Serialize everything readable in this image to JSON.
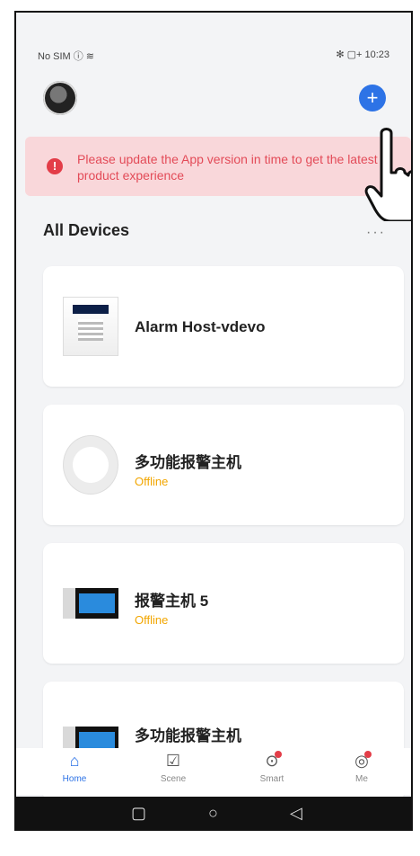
{
  "status_bar": {
    "left": "No SIM ⓘ ≋",
    "right": "✻ ▢+ 10:23"
  },
  "header": {
    "add_symbol": "+"
  },
  "banner": {
    "icon": "!",
    "message": "Please update the App version in time to get the latest product experience"
  },
  "section": {
    "title": "All Devices",
    "more": "···"
  },
  "devices": [
    {
      "name": "Alarm Host-vdevo",
      "status": ""
    },
    {
      "name": "多功能报警主机",
      "status": "Offline"
    },
    {
      "name": "报警主机 5",
      "status": "Offline"
    },
    {
      "name": "多功能报警主机",
      "status": ""
    }
  ],
  "tabs": [
    {
      "label": "Home",
      "icon": "home-icon",
      "glyph": "⌂"
    },
    {
      "label": "Scene",
      "icon": "scene-icon",
      "glyph": "☑"
    },
    {
      "label": "Smart",
      "icon": "smart-icon",
      "glyph": "⊙"
    },
    {
      "label": "Me",
      "icon": "me-icon",
      "glyph": "◎"
    }
  ],
  "navbar": {
    "square": "▢",
    "circle": "○",
    "back": "◁"
  },
  "colors": {
    "accent": "#2d73e6",
    "warning_bg": "#f9d7da",
    "warning_text": "#e34b58",
    "offline": "#f2a600"
  }
}
